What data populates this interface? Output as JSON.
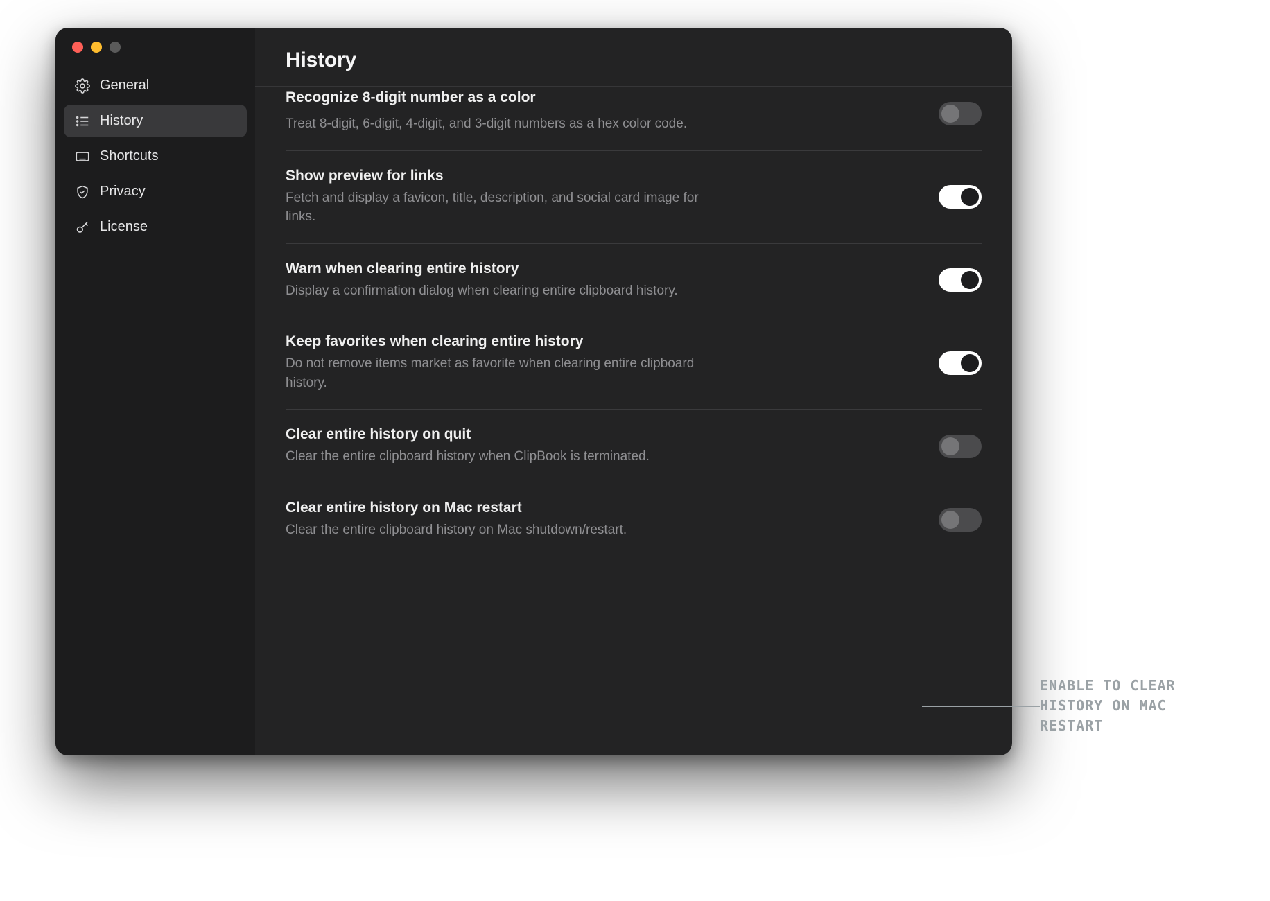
{
  "sidebar": {
    "items": [
      {
        "label": "General",
        "icon": "gear-icon"
      },
      {
        "label": "History",
        "icon": "list-icon"
      },
      {
        "label": "Shortcuts",
        "icon": "keyboard-icon"
      },
      {
        "label": "Privacy",
        "icon": "shield-icon"
      },
      {
        "label": "License",
        "icon": "key-icon"
      }
    ],
    "active_index": 1
  },
  "header": {
    "title": "History"
  },
  "settings": [
    {
      "title": "Recognize 8-digit number as a color",
      "description": "Treat 8-digit, 6-digit, 4-digit, and 3-digit numbers as a hex color code.",
      "enabled": false,
      "clipped": true
    },
    {
      "title": "Show preview for links",
      "description": "Fetch and display a favicon, title, description, and social card image for links.",
      "enabled": true
    },
    {
      "title": "Warn when clearing entire history",
      "description": "Display a confirmation dialog when clearing entire clipboard history.",
      "enabled": true
    },
    {
      "title": "Keep favorites when clearing entire history",
      "description": "Do not remove items market as favorite when clearing entire clipboard history.",
      "enabled": true
    },
    {
      "title": "Clear entire history on quit",
      "description": "Clear the entire clipboard history when ClipBook is terminated.",
      "enabled": false
    },
    {
      "title": "Clear entire history on Mac restart",
      "description": "Clear the entire clipboard history on Mac shutdown/restart.",
      "enabled": false
    }
  ],
  "group_breaks_after": [
    0,
    1,
    3
  ],
  "callout": {
    "text": "ENABLE TO CLEAR\nHISTORY ON MAC\nRESTART"
  }
}
